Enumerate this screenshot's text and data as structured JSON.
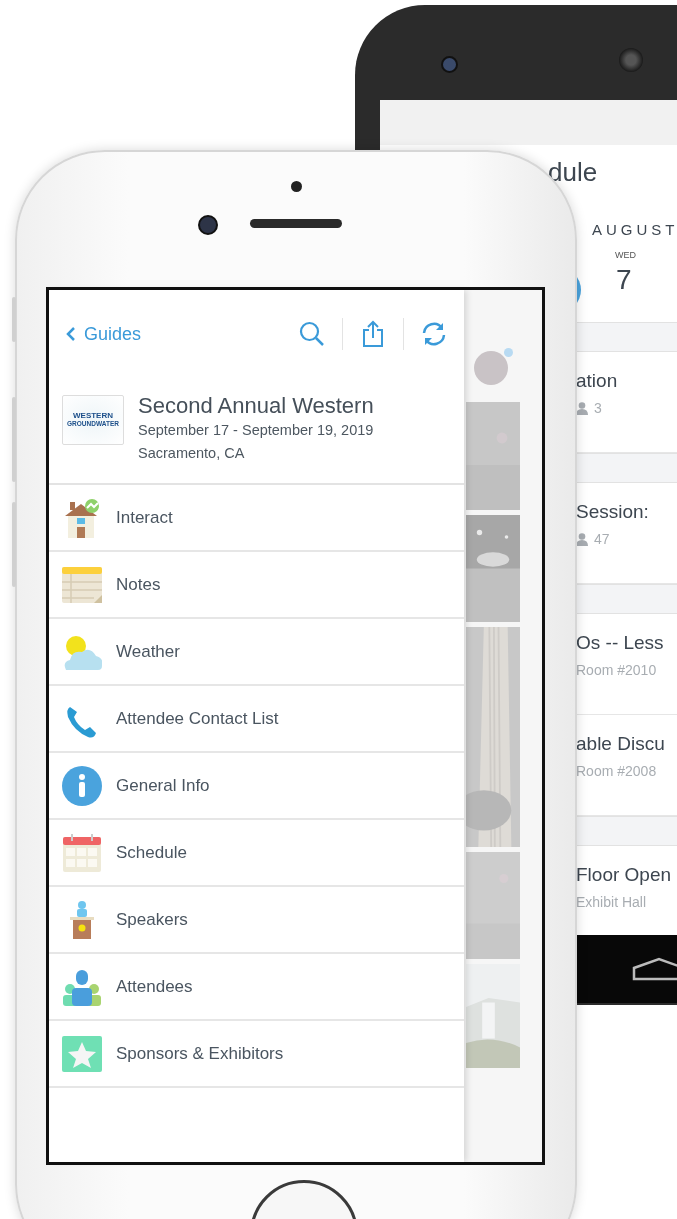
{
  "back_phone": {
    "title": "dule",
    "month": "AUGUST",
    "day": {
      "weekday": "WED",
      "date": "7"
    },
    "sections": [
      {
        "sessions": [
          {
            "title": "ation",
            "kind": "count",
            "meta": "3"
          }
        ]
      },
      {
        "sessions": [
          {
            "title": "Session:",
            "kind": "count",
            "meta": "47"
          }
        ]
      },
      {
        "sessions": [
          {
            "title": "Os -- Less",
            "kind": "room",
            "meta": "Room #2010"
          },
          {
            "title": "able Discu",
            "kind": "room",
            "meta": "Room #2008"
          }
        ]
      },
      {
        "sessions": [
          {
            "title": "Floor Open",
            "kind": "room",
            "meta": "Exhibit Hall"
          }
        ]
      }
    ]
  },
  "front_phone": {
    "nav": {
      "back_label": "Guides"
    },
    "event": {
      "logo_text": [
        "WESTERN",
        "GROUNDWATER"
      ],
      "title": "Second Annual Western",
      "dates": "September 17 - September 19, 2019",
      "location": "Sacramento, CA"
    },
    "menu": [
      {
        "label": "Interact"
      },
      {
        "label": "Notes"
      },
      {
        "label": "Weather"
      },
      {
        "label": "Attendee Contact List"
      },
      {
        "label": "General Info"
      },
      {
        "label": "Schedule"
      },
      {
        "label": "Speakers"
      },
      {
        "label": "Attendees"
      },
      {
        "label": "Sponsors & Exhibitors"
      }
    ]
  }
}
